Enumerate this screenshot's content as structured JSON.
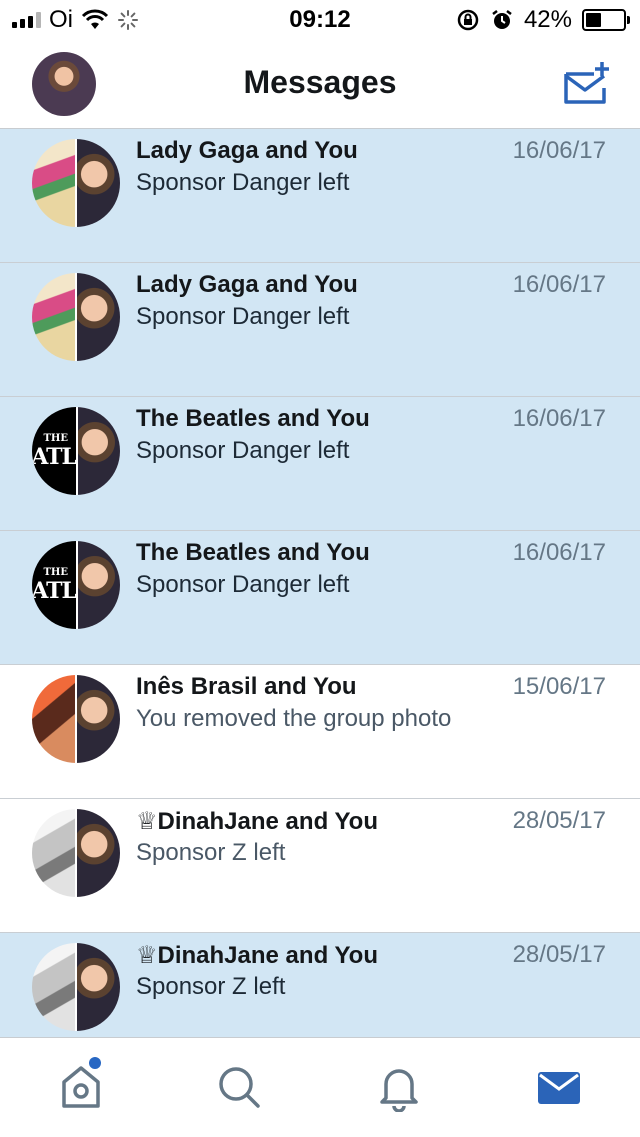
{
  "status_bar": {
    "carrier": "Oi",
    "time": "09:12",
    "battery_percent": "42%",
    "battery_level": 0.42,
    "icons": [
      "signal-icon",
      "wifi-icon",
      "activity-spinner-icon",
      "rotation-lock-icon",
      "alarm-icon",
      "battery-icon"
    ]
  },
  "header": {
    "title": "Messages",
    "compose_icon": "compose-message-icon"
  },
  "colors": {
    "accent": "#2b64b8",
    "unread_bg": "#d2e6f4",
    "divider": "#c9ced3"
  },
  "conversations": [
    {
      "title": "Lady Gaga and You",
      "date": "16/06/17",
      "preview": "Sponsor Danger left",
      "unread": true,
      "avatar": "gaga"
    },
    {
      "title": "Lady Gaga and You",
      "date": "16/06/17",
      "preview": "Sponsor Danger left",
      "unread": true,
      "avatar": "gaga"
    },
    {
      "title": "The Beatles and You",
      "date": "16/06/17",
      "preview": "Sponsor Danger left",
      "unread": true,
      "avatar": "beatles"
    },
    {
      "title": "The Beatles and You",
      "date": "16/06/17",
      "preview": "Sponsor Danger left",
      "unread": true,
      "avatar": "beatles"
    },
    {
      "title": "Inês Brasil and You",
      "date": "15/06/17",
      "preview": "You removed the group photo",
      "unread": false,
      "avatar": "ines"
    },
    {
      "title": "♕DinahJane and You",
      "date": "28/05/17",
      "preview": "Sponsor Z left",
      "unread": false,
      "avatar": "dinah"
    },
    {
      "title": "♕DinahJane and You",
      "date": "28/05/17",
      "preview": "Sponsor Z left",
      "unread": true,
      "avatar": "dinah"
    }
  ],
  "beatles_logo": {
    "line1": "THE",
    "line2": "EATL"
  },
  "tab_bar": {
    "tabs": [
      "home-icon",
      "search-icon",
      "notifications-icon",
      "messages-icon"
    ],
    "active": "messages-icon"
  }
}
